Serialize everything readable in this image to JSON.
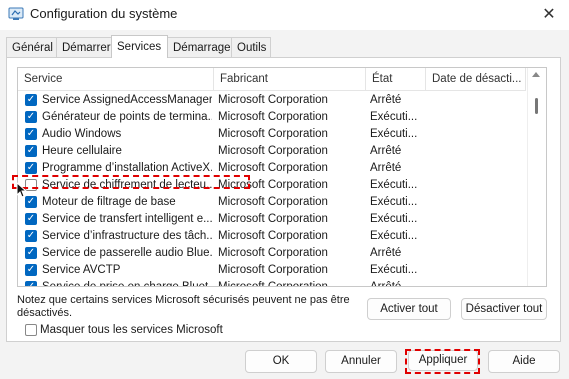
{
  "window": {
    "title": "Configuration du système",
    "close_icon": "close-icon"
  },
  "tabs": [
    {
      "label": "Général"
    },
    {
      "label": "Démarrer"
    },
    {
      "label": "Services"
    },
    {
      "label": "Démarrage"
    },
    {
      "label": "Outils"
    }
  ],
  "active_tab": "Services",
  "columns": {
    "service": "Service",
    "manufacturer": "Fabricant",
    "state": "État",
    "date": "Date de désacti..."
  },
  "rows": [
    {
      "name": "Service AssignedAccessManager",
      "manufacturer": "Microsoft Corporation",
      "state": "Arrêté",
      "checked": true
    },
    {
      "name": "Générateur de points de termina...",
      "manufacturer": "Microsoft Corporation",
      "state": "Exécuti...",
      "checked": true
    },
    {
      "name": "Audio Windows",
      "manufacturer": "Microsoft Corporation",
      "state": "Exécuti...",
      "checked": true
    },
    {
      "name": "Heure cellulaire",
      "manufacturer": "Microsoft Corporation",
      "state": "Arrêté",
      "checked": true
    },
    {
      "name": "Programme d’installation ActiveX...",
      "manufacturer": "Microsoft Corporation",
      "state": "Arrêté",
      "checked": true
    },
    {
      "name": "Service de chiffrement de lecteu...",
      "manufacturer": "Microsoft Corporation",
      "state": "Exécuti...",
      "checked": false
    },
    {
      "name": "Moteur de filtrage de base",
      "manufacturer": "Microsoft Corporation",
      "state": "Exécuti...",
      "checked": true
    },
    {
      "name": "Service de transfert intelligent e...",
      "manufacturer": "Microsoft Corporation",
      "state": "Exécuti...",
      "checked": true
    },
    {
      "name": "Service d’infrastructure des tâch...",
      "manufacturer": "Microsoft Corporation",
      "state": "Exécuti...",
      "checked": true
    },
    {
      "name": "Service de passerelle audio Blue...",
      "manufacturer": "Microsoft Corporation",
      "state": "Arrêté",
      "checked": true
    },
    {
      "name": "Service AVCTP",
      "manufacturer": "Microsoft Corporation",
      "state": "Exécuti...",
      "checked": true
    },
    {
      "name": "Service de prise en charge Bluet...",
      "manufacturer": "Microsoft Corporation",
      "state": "Arrêté",
      "checked": true
    }
  ],
  "note": "Notez que certains services Microsoft sécurisés peuvent ne pas être désactivés.",
  "buttons": {
    "enable_all": "Activer tout",
    "disable_all": "Désactiver tout",
    "ok": "OK",
    "cancel": "Annuler",
    "apply": "Appliquer",
    "help": "Aide"
  },
  "hide_ms": {
    "label": "Masquer tous les services Microsoft",
    "checked": false
  },
  "accent_color": "#0067c0",
  "highlight_color": "#e00000"
}
